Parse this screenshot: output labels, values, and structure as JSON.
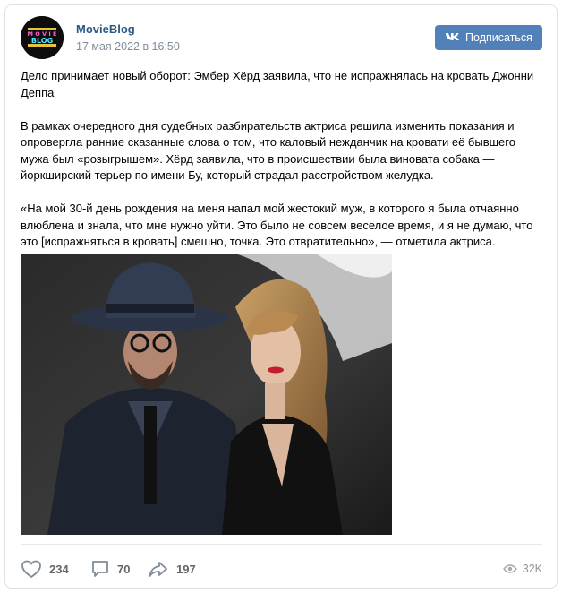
{
  "post": {
    "author": "MovieBlog",
    "date": "17 мая 2022 в 16:50",
    "subscribe_label": "Подписаться",
    "subscribe_icon": "vk-logo-icon",
    "avatar_text": "MOVIE BLOG",
    "paragraphs": [
      "Дело принимает новый оборот: Эмбер Хёрд заявила, что не испражнялась на кровать Джонни Деппа",
      "В рамках очередного дня судебных разбирательств актриса решила изменить показания и опровергла ранние сказанные слова о том, что каловый нежданчик на кровати её бывшего мужа был «розыгрышем». Хёрд заявила, что в происшествии была виновата собака — йоркширский терьер по имени Бу, который страдал расстройством желудка.",
      "«На мой 30-й день рождения на меня напал мой жестокий муж, в которого я была отчаянно влюблена и знала, что мне нужно уйти. Это было не совсем веселое время, и я не думаю, что это [испражняться в кровать] смешно, точка. Это отвратительно», — отметила актриса."
    ]
  },
  "actions": {
    "likes": "234",
    "comments": "70",
    "shares": "197",
    "views": "32K"
  },
  "colors": {
    "link": "#2a5885",
    "button": "#5181b8",
    "muted": "#818c99"
  }
}
